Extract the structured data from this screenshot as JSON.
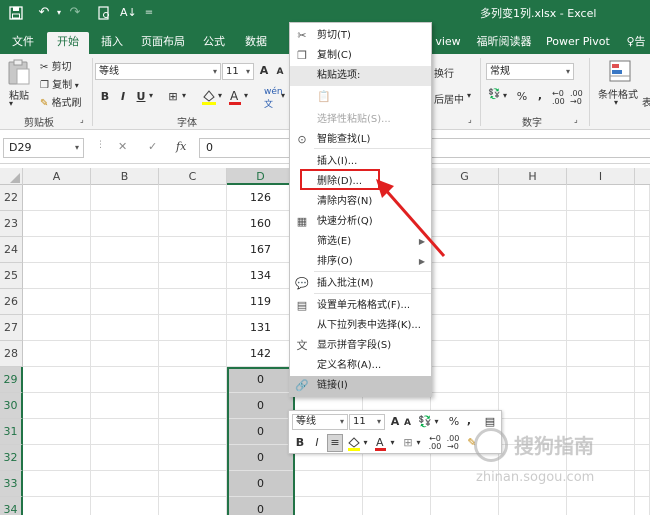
{
  "window": {
    "title": "多列变1列.xlsx  -  Excel",
    "quick_access": {
      "undo": "↶",
      "redo": "↷",
      "more": "="
    }
  },
  "tabs": [
    {
      "label": "文件"
    },
    {
      "label": "开始",
      "active": true
    },
    {
      "label": "插入"
    },
    {
      "label": "页面布局"
    },
    {
      "label": "公式"
    },
    {
      "label": "数据"
    },
    {
      "label": "view"
    },
    {
      "label": "福昕阅读器"
    },
    {
      "label": "Power Pivot"
    },
    {
      "label": "告"
    }
  ],
  "ribbon": {
    "paste_label": "粘贴",
    "cut_label": "剪切",
    "copy_label": "复制",
    "format_painter_label": "格式刷",
    "clipboard_group": "剪贴板",
    "font_name": "等线",
    "font_size": "11",
    "font_grow": "A",
    "font_shrink": "A",
    "bold": "B",
    "italic": "I",
    "underline": "U",
    "font_group": "字体",
    "wrap_label": "换行",
    "merge_label": "后居中",
    "number_format": "常规",
    "percent": "%",
    "comma": ",",
    "number_group": "数字",
    "conditional_label": "条件格式"
  },
  "formula_bar": {
    "name_box": "D29",
    "cancel": "✕",
    "enter": "✓",
    "fx": "fx",
    "value": "0"
  },
  "grid": {
    "columns": [
      "A",
      "B",
      "C",
      "D",
      "E",
      "F",
      "G",
      "H",
      "I"
    ],
    "selected_column": "D",
    "rows": [
      {
        "num": "22",
        "d": "126",
        "selected": false
      },
      {
        "num": "23",
        "d": "160",
        "selected": false
      },
      {
        "num": "24",
        "d": "167",
        "selected": false
      },
      {
        "num": "25",
        "d": "134",
        "selected": false
      },
      {
        "num": "26",
        "d": "119",
        "selected": false
      },
      {
        "num": "27",
        "d": "131",
        "selected": false
      },
      {
        "num": "28",
        "d": "142",
        "selected": false
      },
      {
        "num": "29",
        "d": "0",
        "selected": true
      },
      {
        "num": "30",
        "d": "0",
        "selected": true
      },
      {
        "num": "31",
        "d": "0",
        "selected": true
      },
      {
        "num": "32",
        "d": "0",
        "selected": true
      },
      {
        "num": "33",
        "d": "0",
        "selected": true
      },
      {
        "num": "34",
        "d": "0",
        "selected": true
      }
    ]
  },
  "context_menu": {
    "items": [
      {
        "label": "剪切(T)",
        "icon": "scissors-icon",
        "glyph": "✂"
      },
      {
        "label": "复制(C)",
        "icon": "copy-icon",
        "glyph": "❐"
      },
      {
        "label": "粘贴选项:",
        "header": true
      },
      {
        "label": "",
        "icon": "paste-icon",
        "glyph": "📋",
        "paste_icon_row": true
      },
      {
        "label": "选择性粘贴(S)...",
        "disabled": true
      },
      {
        "label": "智能查找(L)",
        "icon": "smart-lookup-icon",
        "glyph": "⊙"
      },
      {
        "label": "插入(I)..."
      },
      {
        "label": "删除(D)...",
        "boxed": true
      },
      {
        "label": "清除内容(N)"
      },
      {
        "label": "快速分析(Q)",
        "icon": "quick-analysis-icon",
        "glyph": "▦"
      },
      {
        "label": "筛选(E)",
        "submenu": true
      },
      {
        "label": "排序(O)",
        "submenu": true
      },
      {
        "label": "插入批注(M)",
        "icon": "comment-icon",
        "glyph": "💬"
      },
      {
        "label": "设置单元格格式(F)...",
        "icon": "format-cells-icon",
        "glyph": "▤"
      },
      {
        "label": "从下拉列表中选择(K)..."
      },
      {
        "label": "显示拼音字段(S)",
        "icon": "phonetic-icon",
        "glyph": "文"
      },
      {
        "label": "定义名称(A)..."
      },
      {
        "label": "链接(I)",
        "icon": "link-icon",
        "glyph": "🔗",
        "highlighted": true
      }
    ]
  },
  "mini_toolbar": {
    "font_name": "等线",
    "font_size": "11",
    "grow": "A",
    "shrink": "A",
    "percent": "%",
    "comma": ",",
    "bold": "B",
    "italic": "I"
  },
  "annotation": {
    "color": "#e02020"
  },
  "colors": {
    "excel_green": "#217346",
    "selection_gray": "#c9c9c9"
  },
  "watermark": {
    "text": "搜狗指南",
    "url": "zhinan.sogou.com"
  }
}
